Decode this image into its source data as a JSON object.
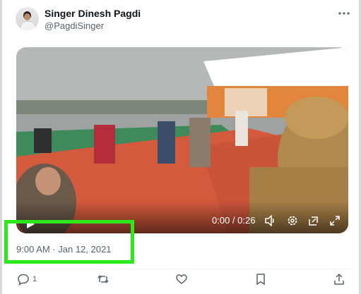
{
  "author": {
    "display_name": "Singer Dinesh Pagdi",
    "handle": "@PagdiSinger",
    "avatar_icon": "person-portrait"
  },
  "video": {
    "time_readout": "0:00 / 0:26",
    "progress": 0.0,
    "controls": [
      "play-icon",
      "volume-icon",
      "settings-icon",
      "picture-in-picture-icon",
      "fullscreen-icon"
    ]
  },
  "tweet": {
    "timestamp": "9:00 AM · Jan 12, 2021"
  },
  "actions": {
    "reply_count": "1",
    "icons": [
      "reply-icon",
      "retweet-icon",
      "like-icon",
      "bookmark-icon",
      "share-icon"
    ]
  },
  "colors": {
    "highlight": "#2ee81b",
    "secondary_text": "#536471",
    "primary_text": "#0f1419"
  }
}
